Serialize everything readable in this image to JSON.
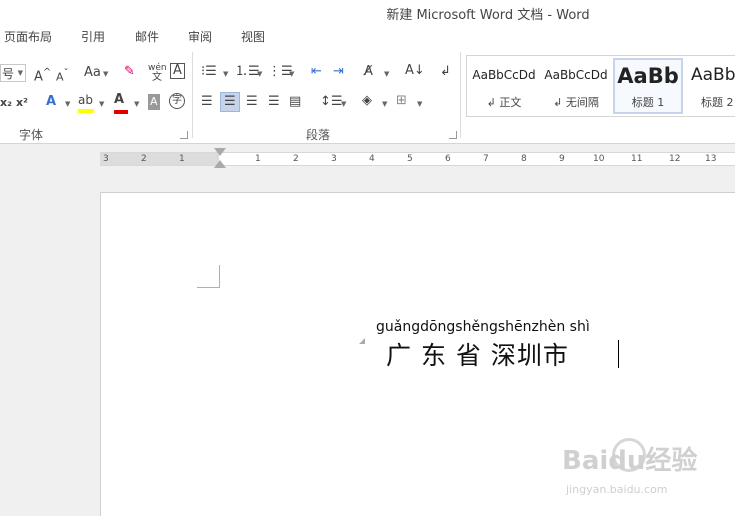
{
  "window": {
    "title": "新建 Microsoft Word 文档 - Word"
  },
  "tabs": [
    "页面布局",
    "引用",
    "邮件",
    "审阅",
    "视图"
  ],
  "ribbon": {
    "font_size_value": "号",
    "font_group_label": "字体",
    "paragraph_group_label": "段落",
    "change_case_label": "Aa",
    "phonetic_top": "wén",
    "phonetic_bottom": "文",
    "char_border_label": "A",
    "subscript_label": "x₂",
    "superscript_label": "x²",
    "enclose_char_label": "字",
    "highlight_color": "#ffff00",
    "font_color": "#e00000",
    "styles": [
      {
        "sample": "AaBbCcDd",
        "name": "↲ 正文"
      },
      {
        "sample": "AaBbCcDd",
        "name": "↲ 无间隔"
      },
      {
        "sample": "AaBb",
        "name": "标题 1"
      },
      {
        "sample": "AaBb",
        "name": "标题 2"
      }
    ]
  },
  "ruler": {
    "numbers": [
      "3",
      "2",
      "1",
      "1",
      "2",
      "3",
      "4",
      "5",
      "6",
      "7",
      "8",
      "9",
      "10",
      "11",
      "12",
      "13"
    ]
  },
  "document": {
    "pinyin": "guǎngdōngshěngshēnzhèn shì",
    "text": "广 东 省 深圳市"
  },
  "watermark": {
    "text": "Baidu经验",
    "url": "jingyan.baidu.com"
  }
}
